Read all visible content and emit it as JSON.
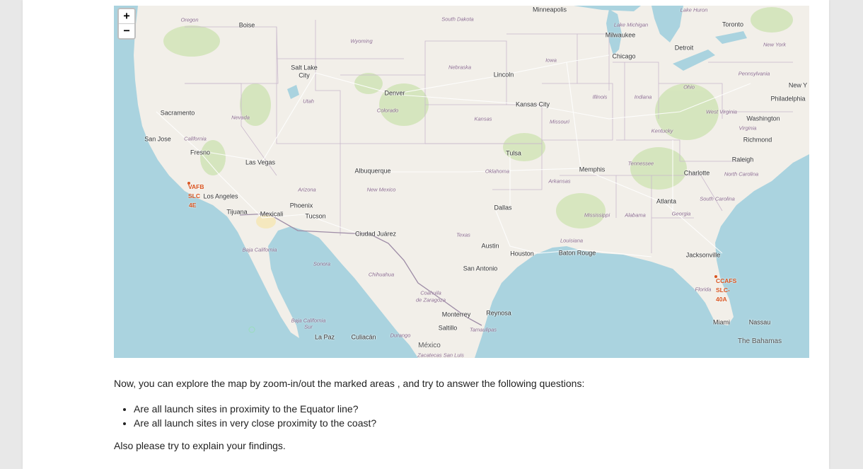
{
  "map": {
    "zoom_in_label": "+",
    "zoom_out_label": "−",
    "cities": {
      "minneapolis": "Minneapolis",
      "toronto": "Toronto",
      "milwaukee": "Milwaukee",
      "detroit": "Detroit",
      "chicago": "Chicago",
      "new_york": "New Y",
      "philadelphia": "Philadelphia",
      "washington": "Washington",
      "richmond": "Richmond",
      "raleigh": "Raleigh",
      "charlotte": "Charlotte",
      "boise": "Boise",
      "salt_lake_city_1": "Salt Lake",
      "salt_lake_city_2": "City",
      "denver": "Denver",
      "lincoln": "Lincoln",
      "kansas_city": "Kansas City",
      "sacramento": "Sacramento",
      "san_jose": "San Jose",
      "fresno": "Fresno",
      "las_vegas": "Las Vegas",
      "los_angeles": "Los Angeles",
      "tijuana": "Tijuana",
      "mexicali": "Mexicali",
      "phoenix": "Phoenix",
      "tucson": "Tucson",
      "albuquerque": "Albuquerque",
      "tulsa": "Tulsa",
      "memphis": "Memphis",
      "dallas": "Dallas",
      "atlanta": "Atlanta",
      "ciudad_juarez": "Ciudad Juárez",
      "austin": "Austin",
      "houston": "Houston",
      "baton_rouge": "Baton Rouge",
      "san_antonio": "San Antonio",
      "jacksonville": "Jacksonville",
      "monterrey": "Monterrey",
      "reynosa": "Reynosa",
      "saltillo": "Saltillo",
      "la_paz": "La Paz",
      "culiacan": "Culiacán",
      "miami": "Miami",
      "nassau": "Nassau"
    },
    "states": {
      "oregon": "Oregon",
      "south_dakota": "South Dakota",
      "wyoming": "Wyoming",
      "lake_michigan": "Lake Michigan",
      "lake_huron": "Lake Huron",
      "new_york_state": "New York",
      "iowa": "Iowa",
      "nebraska": "Nebraska",
      "pennsylvania": "Pennsylvania",
      "ohio": "Ohio",
      "illinois": "Illinois",
      "indiana": "Indiana",
      "utah": "Utah",
      "colorado": "Colorado",
      "nevada": "Nevada",
      "kansas": "Kansas",
      "missouri": "Missouri",
      "west_virginia": "West Virginia",
      "virginia": "Virginia",
      "kentucky": "Kentucky",
      "california": "California",
      "tennessee": "Tennessee",
      "north_carolina": "North Carolina",
      "oklahoma": "Oklahoma",
      "arkansas": "Arkansas",
      "arizona": "Arizona",
      "new_mexico": "New Mexico",
      "south_carolina": "South Carolina",
      "mississippi": "Mississippi",
      "alabama": "Alabama",
      "georgia": "Georgia",
      "texas": "Texas",
      "louisiana": "Louisiana",
      "baja_california": "Baja California",
      "sonora": "Sonora",
      "chihuahua": "Chihuahua",
      "florida": "Florida",
      "coahuila_1": "Coahuila",
      "coahuila_2": "de Zaragoza",
      "baja_california_sur_1": "Baja California",
      "baja_california_sur_2": "Sur",
      "durango": "Durango",
      "tamaulipas": "Tamaulipas",
      "zacatecas": "Zacatecas  San Luis"
    },
    "countries": {
      "mexico": "México",
      "bahamas": "The Bahamas"
    },
    "launch_sites": {
      "west": [
        "VAFB",
        "SLC",
        "4E"
      ],
      "east": [
        "CCAFS",
        "SLC-",
        "40A"
      ]
    },
    "colors": {
      "land": "#f2efe9",
      "water": "#aad3df",
      "marker": "#d9531e",
      "border": "#9e8ca6"
    }
  },
  "text": {
    "intro": "Now, you can explore the map by zoom-in/out the marked areas , and try to answer the following questions:",
    "questions": [
      "Are all launch sites in proximity to the Equator line?",
      "Are all launch sites in very close proximity to the coast?"
    ],
    "outro": "Also please try to explain your findings."
  }
}
